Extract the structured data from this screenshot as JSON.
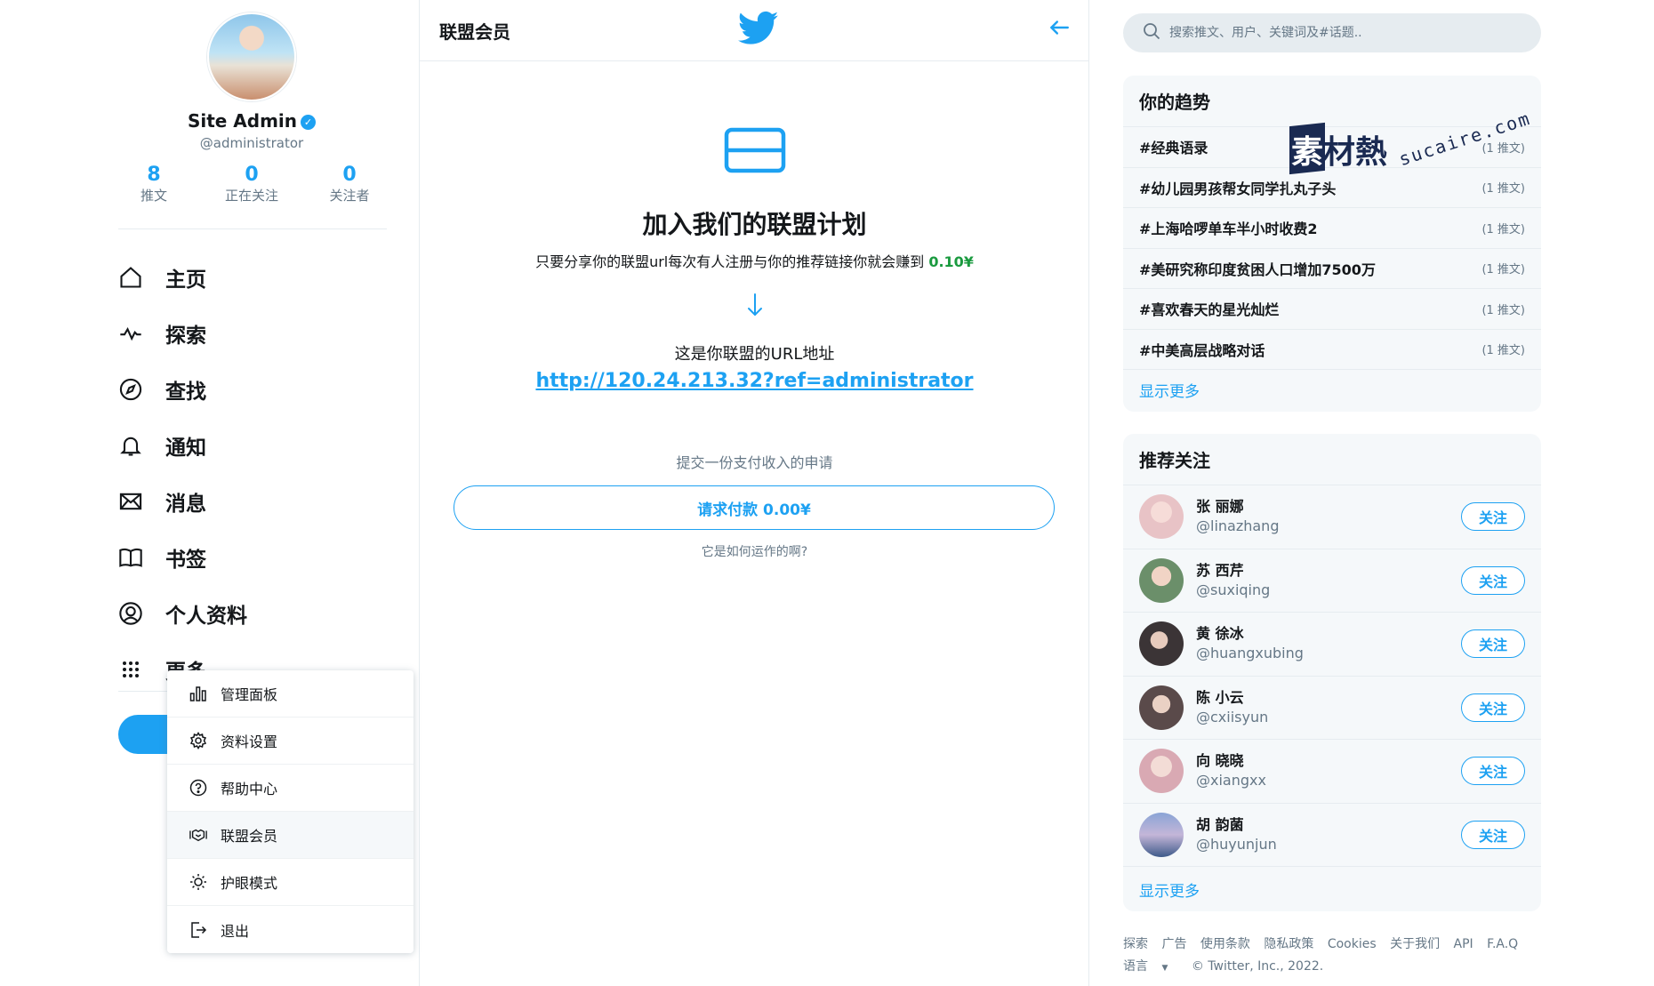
{
  "profile": {
    "name": "Site Admin",
    "handle": "@administrator",
    "stats": [
      {
        "num": "8",
        "label": "推文"
      },
      {
        "num": "0",
        "label": "正在关注"
      },
      {
        "num": "0",
        "label": "关注者"
      }
    ]
  },
  "nav": [
    {
      "label": "主页",
      "icon": "home-icon"
    },
    {
      "label": "探索",
      "icon": "activity-icon"
    },
    {
      "label": "查找",
      "icon": "compass-icon"
    },
    {
      "label": "通知",
      "icon": "bell-icon"
    },
    {
      "label": "消息",
      "icon": "mail-icon"
    },
    {
      "label": "书签",
      "icon": "book-icon"
    },
    {
      "label": "个人资料",
      "icon": "user-circle-icon"
    },
    {
      "label": "更多",
      "icon": "grid-dots-icon"
    }
  ],
  "dropdown": [
    {
      "label": "管理面板",
      "icon": "bar-chart-icon"
    },
    {
      "label": "资料设置",
      "icon": "gear-icon"
    },
    {
      "label": "帮助中心",
      "icon": "help-icon"
    },
    {
      "label": "联盟会员",
      "icon": "handshake-icon"
    },
    {
      "label": "护眼模式",
      "icon": "sun-icon"
    },
    {
      "label": "退出",
      "icon": "logout-icon"
    }
  ],
  "middle": {
    "title": "联盟会员",
    "heading": "加入我们的联盟计划",
    "desc_prefix": "只要分享你的联盟url每次有人注册与你的推荐链接你就会赚到",
    "desc_amount": "0.10¥",
    "url_label": "这是你联盟的URL地址",
    "url": "http://120.24.213.32?ref=administrator",
    "submit_hint": "提交一份支付收入的申请",
    "request_btn": "请求付款 0.00¥",
    "how_link": "它是如何运作的啊?"
  },
  "search": {
    "placeholder": "搜索推文、用户、关键词及#话题.."
  },
  "trends": {
    "title": "你的趋势",
    "items": [
      {
        "tag": "#经典语录",
        "count": "(1 推文)"
      },
      {
        "tag": "#幼儿园男孩帮女同学扎丸子头",
        "count": "(1 推文)"
      },
      {
        "tag": "#上海哈啰单车半小时收费2",
        "count": "(1 推文)"
      },
      {
        "tag": "#美研究称印度贫困人口增加7500万",
        "count": "(1 推文)"
      },
      {
        "tag": "#喜欢春天的星光灿烂",
        "count": "(1 推文)"
      },
      {
        "tag": "#中美高层战略对话",
        "count": "(1 推文)"
      }
    ],
    "show_more": "显示更多"
  },
  "follow": {
    "title": "推荐关注",
    "button": "关注",
    "items": [
      {
        "name": "张 丽娜",
        "handle": "@linazhang",
        "color": "#e8c3c6"
      },
      {
        "name": "苏 西芹",
        "handle": "@suxiqing",
        "color": "#6b8f6a"
      },
      {
        "name": "黄 徐冰",
        "handle": "@huangxubing",
        "color": "#3b3436"
      },
      {
        "name": "陈 小云",
        "handle": "@cxiisyun",
        "color": "#5a4a4a"
      },
      {
        "name": "向 晓晓",
        "handle": "@xiangxx",
        "color": "#d9a9b3"
      },
      {
        "name": "胡 韵菌",
        "handle": "@huyunjun",
        "color": "#3e5a8a"
      }
    ],
    "show_more": "显示更多"
  },
  "footer": {
    "links": [
      "探索",
      "广告",
      "使用条款",
      "隐私政策",
      "Cookies",
      "关于我们",
      "API",
      "F.A.Q"
    ],
    "language": "语言",
    "copyright": "© Twitter, Inc., 2022."
  },
  "watermark": {
    "cn": "素材熱",
    "en": "sucaire.com"
  },
  "colors": {
    "accent": "#1da1f2",
    "amount": "#1a9a3f",
    "muted": "#657786"
  }
}
